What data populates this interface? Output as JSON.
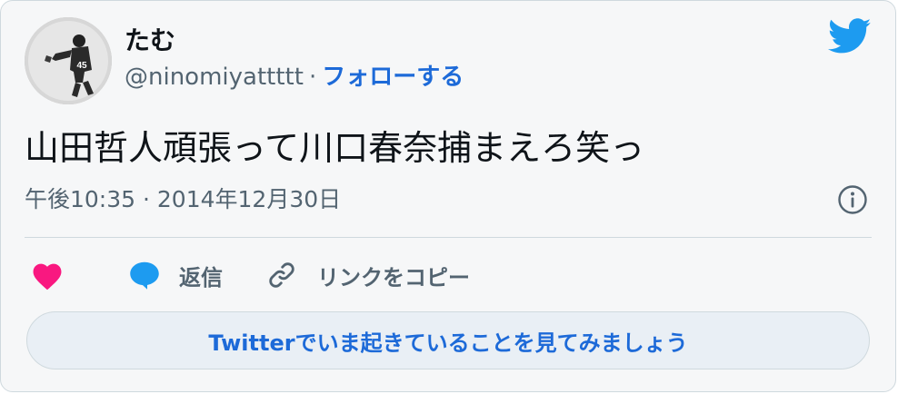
{
  "author": {
    "name": "たむ",
    "handle": "@ninomiyattttt",
    "separator": "·",
    "follow_label": "フォローする"
  },
  "tweet": {
    "text": "山田哲人頑張って川口春奈捕まえろ笑っ",
    "timestamp": "午後10:35 · 2014年12月30日"
  },
  "actions": {
    "like_icon": "heart-icon",
    "reply_label": "返信",
    "reply_icon": "speech-bubble-icon",
    "copy_link_label": "リンクをコピー",
    "copy_link_icon": "link-icon"
  },
  "cta_label": "Twitterでいま起きていることを見てみましょう",
  "colors": {
    "accent_blue": "#1d6ad8",
    "twitter_blue": "#1d9bf0",
    "heart_pink": "#f91880",
    "muted_text": "#536471"
  }
}
